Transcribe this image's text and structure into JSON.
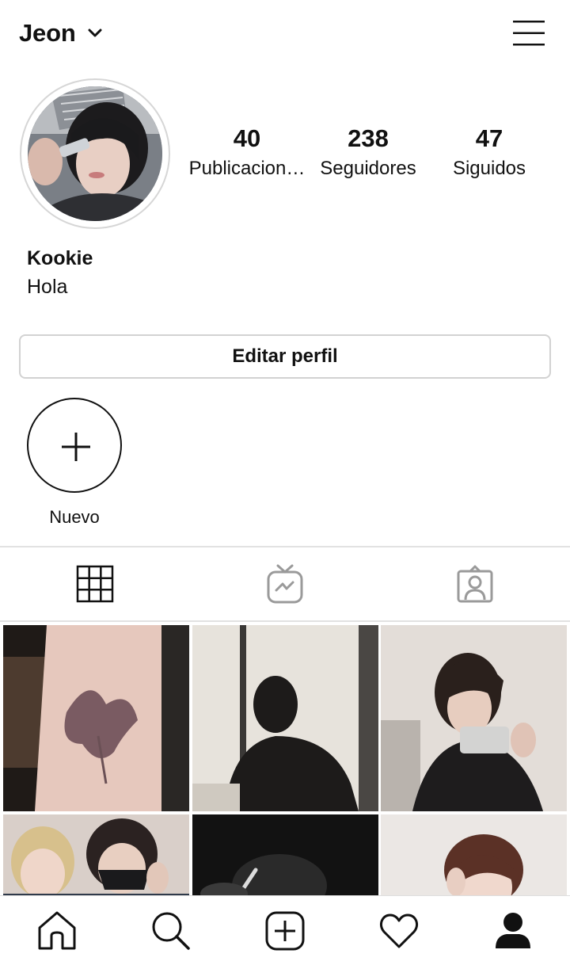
{
  "header": {
    "username": "Jeon",
    "account_switch_icon": "chevron-down-icon",
    "menu_icon": "hamburger-menu-icon"
  },
  "profile": {
    "avatar_alt": "profile-photo",
    "stats": [
      {
        "value": "40",
        "label": "Publicacion…"
      },
      {
        "value": "238",
        "label": "Seguidores"
      },
      {
        "value": "47",
        "label": "Siguidos"
      }
    ],
    "display_name": "Kookie",
    "bio": "Hola",
    "edit_button_label": "Editar perfil"
  },
  "highlights": {
    "new_label": "Nuevo",
    "new_icon": "plus-icon"
  },
  "tabs": [
    {
      "icon": "grid-icon",
      "active": true
    },
    {
      "icon": "igtv-icon",
      "active": false
    },
    {
      "icon": "tagged-icon",
      "active": false
    }
  ],
  "posts": [
    {
      "type": "photo",
      "subject": "flower-tattoo"
    },
    {
      "type": "photo",
      "subject": "silhouette-window"
    },
    {
      "type": "photo",
      "subject": "mirror-selfie"
    },
    {
      "type": "photo",
      "subject": "group-photo"
    },
    {
      "type": "photo",
      "subject": "dark-scene"
    },
    {
      "type": "photo",
      "subject": "portrait"
    }
  ],
  "bottom_nav": [
    "home-icon",
    "search-icon",
    "new-post-icon",
    "activity-heart-icon",
    "profile-icon"
  ],
  "colors": {
    "text": "#111111",
    "border": "#d2d2d2",
    "divider": "#e2e2e2",
    "inactive_icon": "#9a9a9a"
  }
}
